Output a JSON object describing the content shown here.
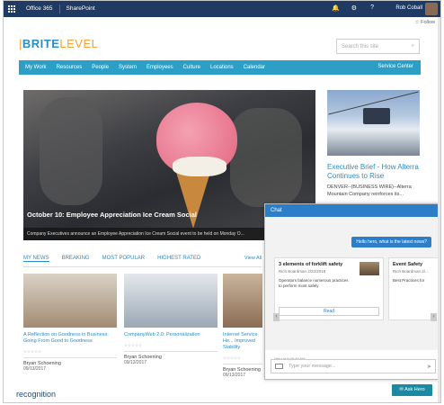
{
  "suite": {
    "app1": "Office 365",
    "app2": "SharePoint",
    "user": "Rob Coball",
    "icons": [
      "bell-icon",
      "gear-icon",
      "help-icon"
    ]
  },
  "follow": "☆ Follow",
  "logo": {
    "part1": "BRITE",
    "part2": "LEVEL"
  },
  "search": {
    "placeholder": "Search this site"
  },
  "nav": {
    "items": [
      "My Work",
      "Resources",
      "People",
      "System",
      "Employees",
      "Culture",
      "Locations",
      "Calendar"
    ],
    "service": "Service Center"
  },
  "hero": {
    "title": "October 10: Employee Appreciation Ice Cream Social",
    "sub": "Company Executives announce an Employee Appreciation Ice Cream Social event to be held on Monday O..."
  },
  "side": {
    "title": "Executive Brief - How Alterra Continues to Rise",
    "text": "DENVER--(BUSINESS WIRE)--Alterra Mountain Company reinforces its..."
  },
  "tabs": [
    "MY NEWS",
    "BREAKING",
    "MOST POPULAR",
    "HIGHEST RATED"
  ],
  "viewall": "View All",
  "cards": [
    {
      "title": "A Reflection on Goodness in Business: Going From Good to Goodness",
      "author": "Bryan Schoening",
      "date": "09/13/2017"
    },
    {
      "title": "CompanyWeb 2.0: Personalization",
      "author": "Bryan Schoening",
      "date": "09/13/2017"
    },
    {
      "title": "Internet Service He... Improved Stability",
      "author": "Bryan Schoening",
      "date": "09/13/2017"
    }
  ],
  "recognition": "recognition",
  "chat": {
    "header": "Chat",
    "bubble": "Hello hero, what is the latest news?",
    "cards": [
      {
        "title": "3 elements of forklift safety",
        "meta": "Rich Boardman 2/22/2018",
        "desc": "Operators balance numerous practices to perform most safely",
        "button": "Read"
      },
      {
        "title": "Event Safety",
        "meta": "Rich Boardman 2/...",
        "desc": "Best Practices for",
        "button": ""
      }
    ],
    "timestamp": "Hero at 9:08:49 AM",
    "input_placeholder": "Type your message..."
  },
  "ask_button": "Ask Hero"
}
